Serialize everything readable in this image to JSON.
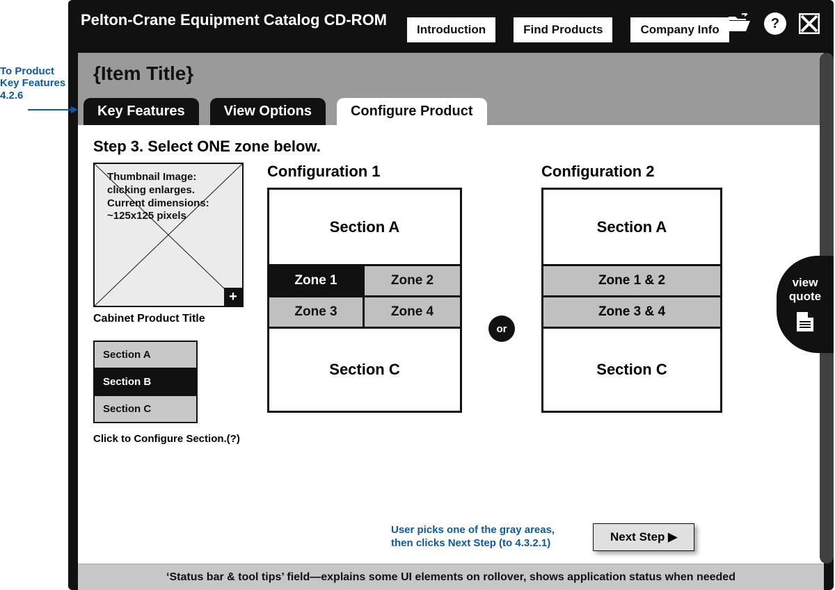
{
  "annotation_left": "To Product Key Features 4.2.6",
  "app_title": "Pelton-Crane Equipment Catalog CD-ROM",
  "nav": {
    "introduction": "Introduction",
    "find_products": "Find Products",
    "company_info": "Company Info"
  },
  "help_label": "?",
  "page_title": "{Item Title}",
  "tabs": {
    "key_features": "Key Features",
    "view_options": "View Options",
    "configure": "Configure Product"
  },
  "step_heading": "Step 3. Select ONE zone below.",
  "thumbnail": {
    "text": "Thumbnail Image: clicking enlarges. Current dimensions: ~125x125  pixels"
  },
  "cabinet_title": "Cabinet Product Title",
  "mini": {
    "a": "Section A",
    "b": "Section B",
    "c": "Section C",
    "caption": "Click to Configure Section.(?)"
  },
  "config1": {
    "title": "Configuration 1",
    "sectionA": "Section A",
    "zone1": "Zone 1",
    "zone2": "Zone 2",
    "zone3": "Zone 3",
    "zone4": "Zone 4",
    "sectionC": "Section C"
  },
  "or_label": "or",
  "config2": {
    "title": "Configuration 2",
    "sectionA": "Section A",
    "zone12": "Zone 1 & 2",
    "zone34": "Zone 3 & 4",
    "sectionC": "Section C"
  },
  "helper_note": "User picks one of the gray areas, then clicks Next Step (to 4.3.2.1)",
  "next_step": "Next Step ▶",
  "view_quote": "view quote",
  "status_bar": "‘Status bar & tool tips’ field—explains some UI elements on rollover, shows application status when needed"
}
